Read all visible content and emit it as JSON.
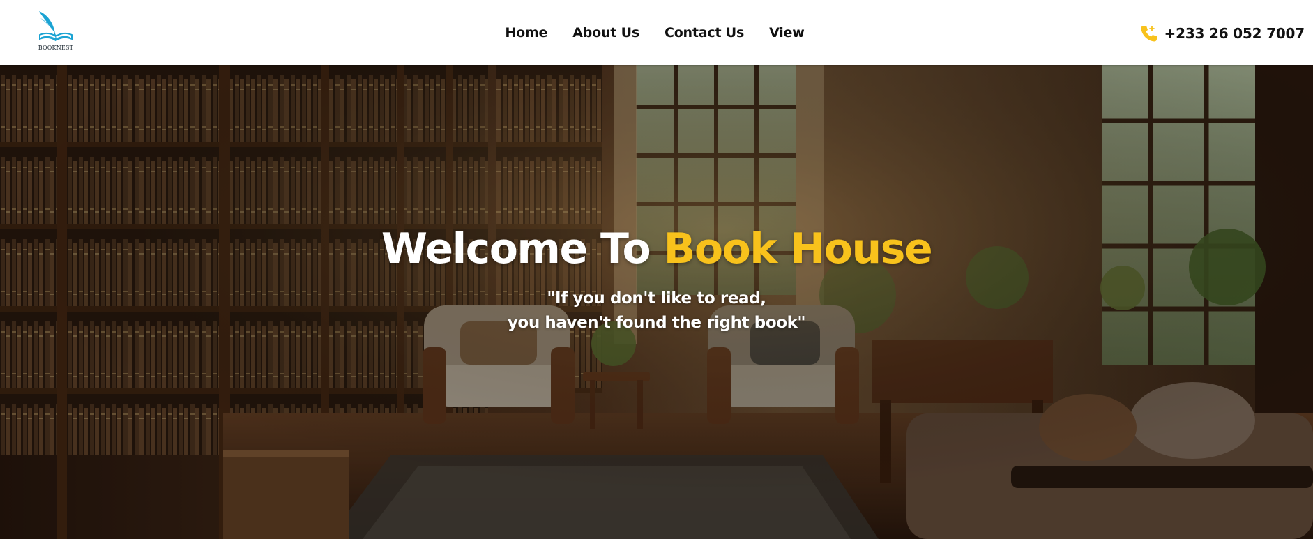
{
  "header": {
    "logo": {
      "text": "BOOKNEST",
      "icon": "book-with-quill"
    },
    "nav": [
      {
        "label": "Home"
      },
      {
        "label": "About Us"
      },
      {
        "label": "Contact Us"
      },
      {
        "label": "View"
      }
    ],
    "phone": {
      "icon": "phone-icon",
      "number": "+233 26 052 7007"
    }
  },
  "hero": {
    "title_prefix": "Welcome To",
    "title_highlight": "Book House",
    "quote_line1": "\"If you don't like to read,",
    "quote_line2": "you haven't found the right book\"",
    "background": "library reading room with bookshelves, armchairs, window and plants"
  },
  "colors": {
    "accent": "#f8c21c",
    "logo_blue": "#29a9d6",
    "text_dark": "#111111",
    "hero_text": "#ffffff"
  }
}
